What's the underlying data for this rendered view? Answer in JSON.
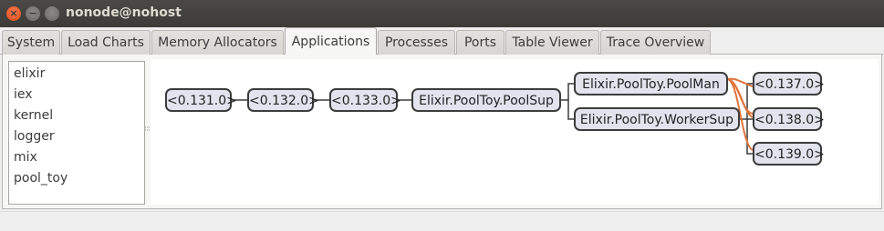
{
  "window": {
    "title": "nonode@nohost"
  },
  "tabs": [
    {
      "label": "System"
    },
    {
      "label": "Load Charts"
    },
    {
      "label": "Memory Allocators"
    },
    {
      "label": "Applications"
    },
    {
      "label": "Processes"
    },
    {
      "label": "Ports"
    },
    {
      "label": "Table Viewer"
    },
    {
      "label": "Trace Overview"
    }
  ],
  "active_tab": "Applications",
  "applications": [
    "elixir",
    "iex",
    "kernel",
    "logger",
    "mix",
    "pool_toy"
  ],
  "tree": {
    "nodes": [
      {
        "label": "<0.131.0>"
      },
      {
        "label": "<0.132.0>"
      },
      {
        "label": "<0.133.0>"
      },
      {
        "label": "Elixir.PoolToy.PoolSup"
      },
      {
        "label": "Elixir.PoolToy.PoolMan"
      },
      {
        "label": "Elixir.PoolToy.WorkerSup"
      },
      {
        "label": "<0.137.0>"
      },
      {
        "label": "<0.138.0>"
      },
      {
        "label": "<0.139.0>"
      }
    ],
    "link_colors": {
      "supervision": "#3c3c3c",
      "link": "#e0733a"
    }
  }
}
